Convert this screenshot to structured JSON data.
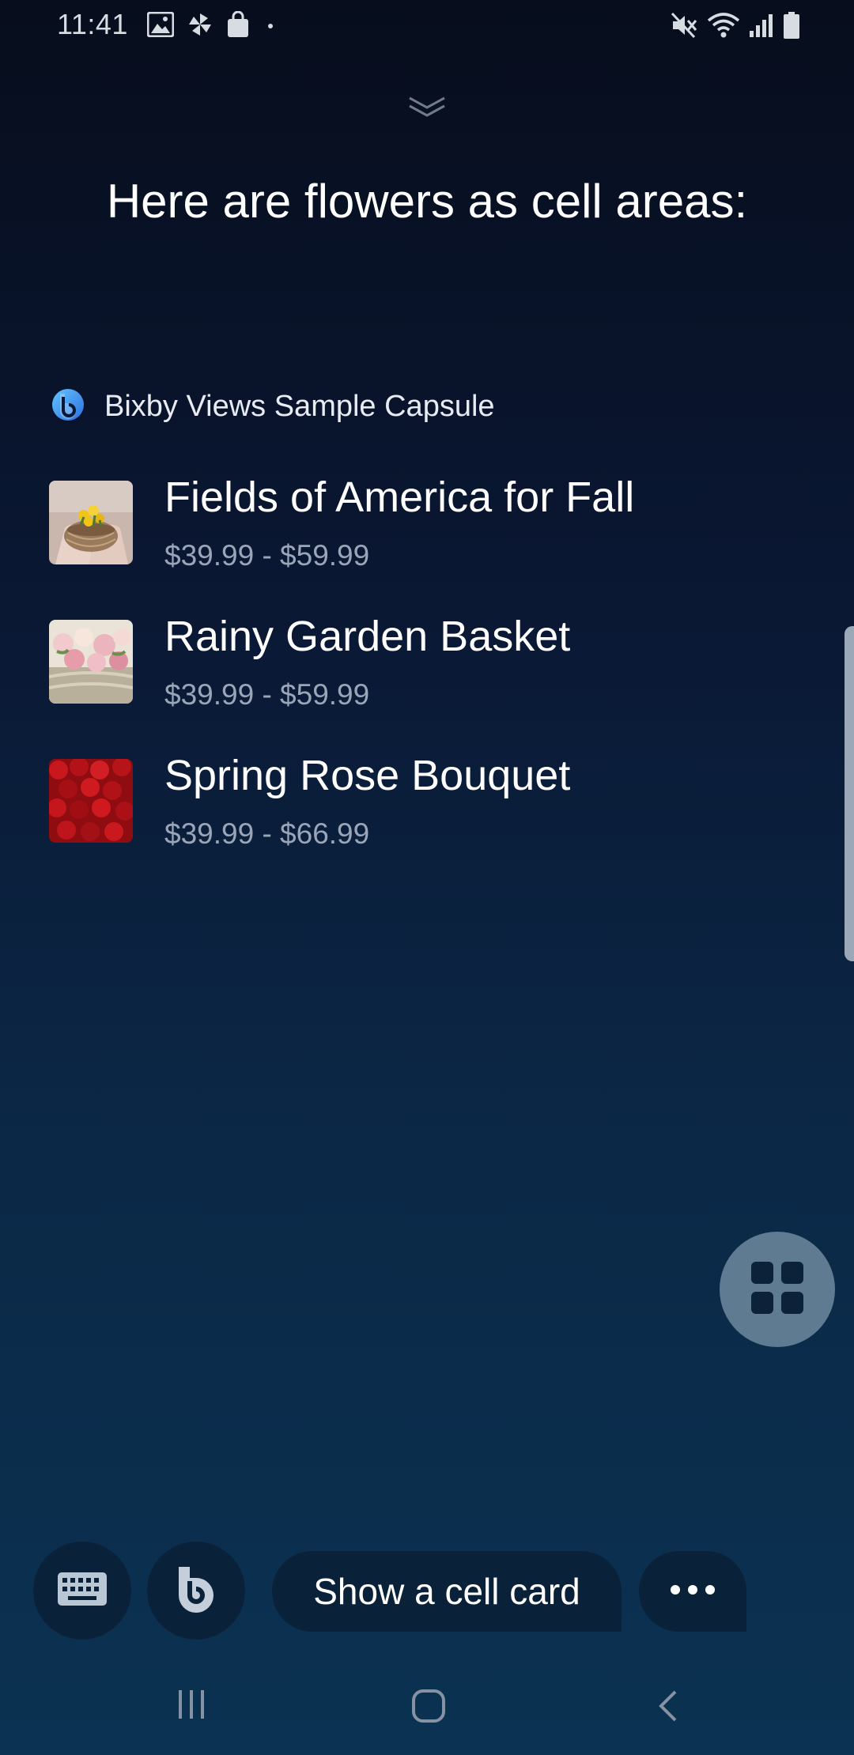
{
  "status_bar": {
    "time": "11:41",
    "left_icons": [
      "image-icon",
      "pinwheel-icon",
      "shopping-bag-icon",
      "dot-icon"
    ],
    "right_icons": [
      "mute-icon",
      "wifi-icon",
      "signal-icon",
      "battery-icon"
    ]
  },
  "headline": "Here are flowers as cell areas:",
  "capsule": {
    "icon": "bixby-logo-icon",
    "name": "Bixby Views Sample Capsule"
  },
  "flowers": [
    {
      "title": "Fields of America for Fall",
      "price": "$39.99 - $59.99",
      "thumb": "wicker-basket-yellow-flowers"
    },
    {
      "title": "Rainy Garden Basket",
      "price": "$39.99 - $59.99",
      "thumb": "pink-roses"
    },
    {
      "title": "Spring Rose Bouquet",
      "price": "$39.99 - $66.99",
      "thumb": "red-roses"
    }
  ],
  "bottom_bar": {
    "keyboard_icon": "keyboard-icon",
    "bixby_icon": "bixby-icon",
    "hint_label": "Show a cell card",
    "more_icon": "more-dots-icon"
  },
  "colors": {
    "background_top": "#070d1c",
    "background_bottom": "#0b3252",
    "chip_background": "#0a2239",
    "price_text": "#9aa6b7",
    "fab": "#5f7b92"
  }
}
